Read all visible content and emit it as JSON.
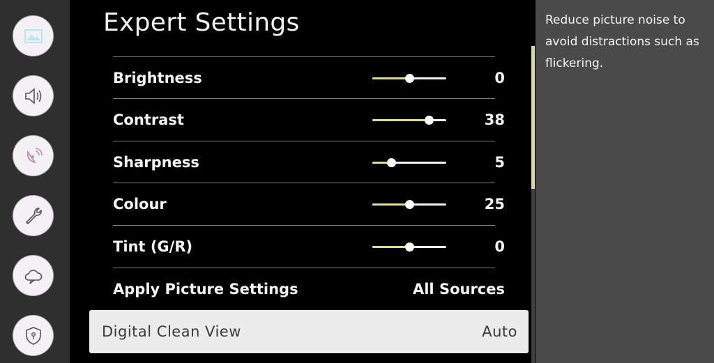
{
  "sidebar": {
    "icons": [
      {
        "name": "picture-icon"
      },
      {
        "name": "sound-icon"
      },
      {
        "name": "broadcasting-icon"
      },
      {
        "name": "general-wrench-icon"
      },
      {
        "name": "support-cloud-icon"
      },
      {
        "name": "privacy-shield-icon"
      }
    ]
  },
  "main": {
    "title": "Expert Settings",
    "settings": [
      {
        "label": "Brightness",
        "value": "0",
        "level": 0.5
      },
      {
        "label": "Contrast",
        "value": "38",
        "level": 0.76
      },
      {
        "label": "Sharpness",
        "value": "5",
        "level": 0.25
      },
      {
        "label": "Colour",
        "value": "25",
        "level": 0.5
      },
      {
        "label": "Tint (G/R)",
        "value": "0",
        "level": 0.5
      }
    ],
    "apply": {
      "label": "Apply Picture Settings",
      "value": "All Sources"
    },
    "focused": {
      "label": "Digital Clean View",
      "value": "Auto"
    }
  },
  "help": {
    "text": "Reduce picture noise to avoid distractions such as flickering."
  },
  "colors": {
    "slider_fill": "#dddd95",
    "scroll_thumb": "#d8d8a4",
    "focus_bg": "#ececec",
    "help_bg": "#4a4a4a",
    "sidebar_bg": "#2f2f2f"
  }
}
